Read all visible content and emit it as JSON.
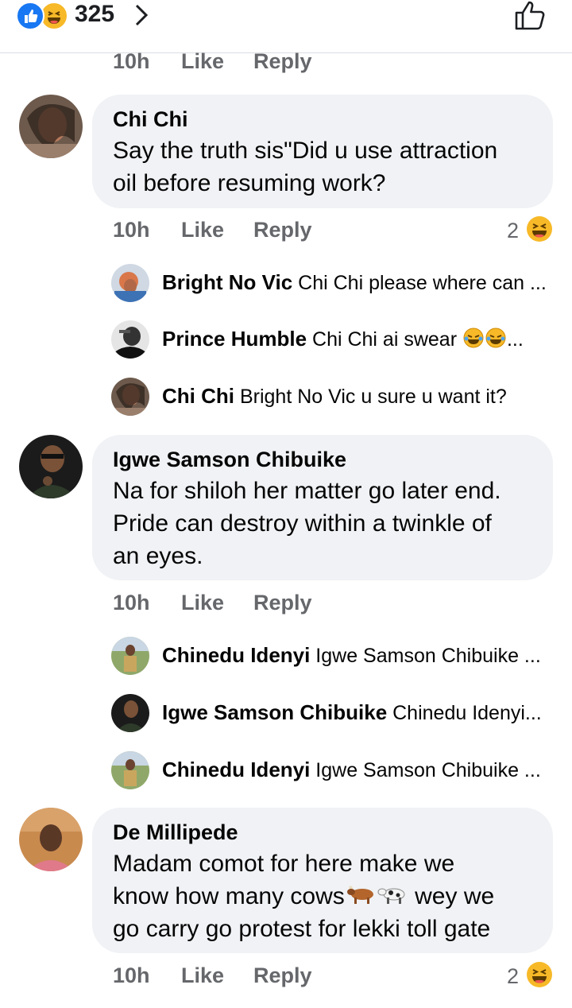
{
  "header": {
    "reaction_count": "325",
    "reaction_icons": [
      "like-reaction-icon",
      "haha-reaction-icon"
    ]
  },
  "top_meta": {
    "time": "10h",
    "like": "Like",
    "reply": "Reply"
  },
  "comments": [
    {
      "author": "Chi Chi",
      "text_lines": [
        "Say the truth sis\"Did u use attraction",
        "oil before resuming work?"
      ],
      "time": "10h",
      "like": "Like",
      "reply": "Reply",
      "reaction_count": "2",
      "replies": [
        {
          "author": "Bright No Vic",
          "text": "Chi Chi please where can ..."
        },
        {
          "author": "Prince Humble",
          "text": "Chi Chi ai swear",
          "trailing": "..."
        },
        {
          "author": "Chi Chi",
          "text": "Bright No Vic u sure u want it?"
        }
      ]
    },
    {
      "author": "Igwe Samson Chibuike",
      "text_lines": [
        "Na for shiloh her matter go later end.",
        "Pride can destroy within a twinkle of",
        "an eyes."
      ],
      "time": "10h",
      "like": "Like",
      "reply": "Reply",
      "replies": [
        {
          "author": "Chinedu Idenyi",
          "text": "Igwe Samson Chibuike ..."
        },
        {
          "author": "Igwe Samson Chibuike",
          "text": "Chinedu Idenyi..."
        },
        {
          "author": "Chinedu Idenyi",
          "text": "Igwe Samson Chibuike ..."
        }
      ]
    },
    {
      "author": "De Millipede",
      "text_lines": [
        "Madam comot for here make we",
        "know how many cows",
        "wey we",
        "go carry go protest for lekki toll gate"
      ],
      "time": "10h",
      "like": "Like",
      "reply": "Reply",
      "reaction_count": "2"
    }
  ],
  "colors": {
    "bubble": "#f0f2f5",
    "meta_text": "#65676b",
    "like_blue": "#1877f2",
    "haha_yellow": "#f7b928"
  }
}
